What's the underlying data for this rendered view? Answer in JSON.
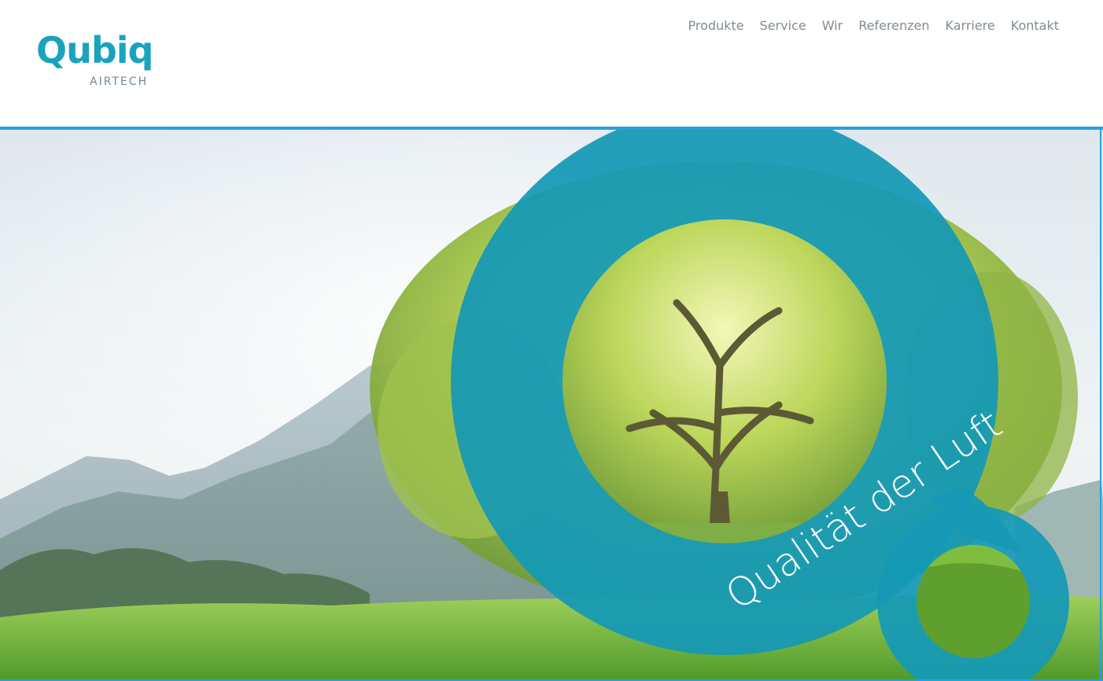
{
  "brand": {
    "name": "Qubiq",
    "subtitle": "AIRTECH"
  },
  "nav": {
    "items": [
      {
        "label": "Produkte"
      },
      {
        "label": "Service"
      },
      {
        "label": "Wir"
      },
      {
        "label": "Referenzen"
      },
      {
        "label": "Karriere"
      },
      {
        "label": "Kontakt"
      }
    ]
  },
  "hero": {
    "slogan": "Qualität der Luft"
  },
  "colors": {
    "brand_teal": "#1aa3bd",
    "accent_blue": "#2a9fe0",
    "nav_text": "#7f8c95"
  }
}
